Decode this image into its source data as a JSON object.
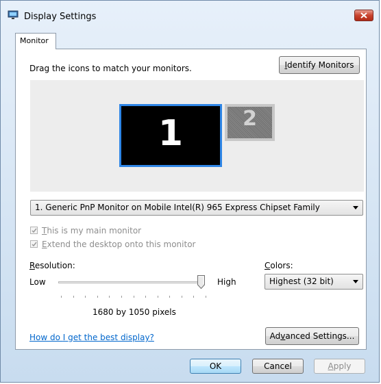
{
  "window": {
    "title": "Display Settings",
    "colors": {
      "frame": "#c8dcef",
      "accent": "#2f86e6",
      "close": "#c9432e",
      "link": "#0066cc"
    }
  },
  "tabs": [
    {
      "label": "Monitor",
      "selected": true
    }
  ],
  "monitor_panel": {
    "instruction": "Drag the icons to match your monitors.",
    "identify_button": {
      "underlined": "I",
      "rest": "dentify Monitors"
    },
    "monitors": [
      {
        "number": "1",
        "selected": true
      },
      {
        "number": "2",
        "selected": false
      }
    ],
    "monitor_select": {
      "value": "1. Generic PnP Monitor on Mobile Intel(R) 965 Express Chipset Family"
    },
    "main_monitor_checkbox": {
      "underlined": "T",
      "rest": "his is my main monitor",
      "checked": true,
      "enabled": false
    },
    "extend_checkbox": {
      "underlined": "E",
      "rest": "xtend the desktop onto this monitor",
      "checked": true,
      "enabled": false
    },
    "resolution": {
      "label_underlined": "R",
      "label_rest": "esolution:",
      "low": "Low",
      "high": "High",
      "slider_fraction": 1.0,
      "readout": "1680 by 1050 pixels"
    },
    "colors": {
      "label_underlined": "C",
      "label_rest": "olors:",
      "value": "Highest (32 bit)"
    },
    "help_link": {
      "pre": "How do ",
      "underlined": "I",
      "post": " get the best display?"
    },
    "advanced_button": {
      "pre": "Ad",
      "underlined": "v",
      "post": "anced Settings..."
    }
  },
  "footer": {
    "ok": "OK",
    "cancel": "Cancel",
    "apply": {
      "underlined": "A",
      "rest": "pply",
      "enabled": false
    }
  }
}
